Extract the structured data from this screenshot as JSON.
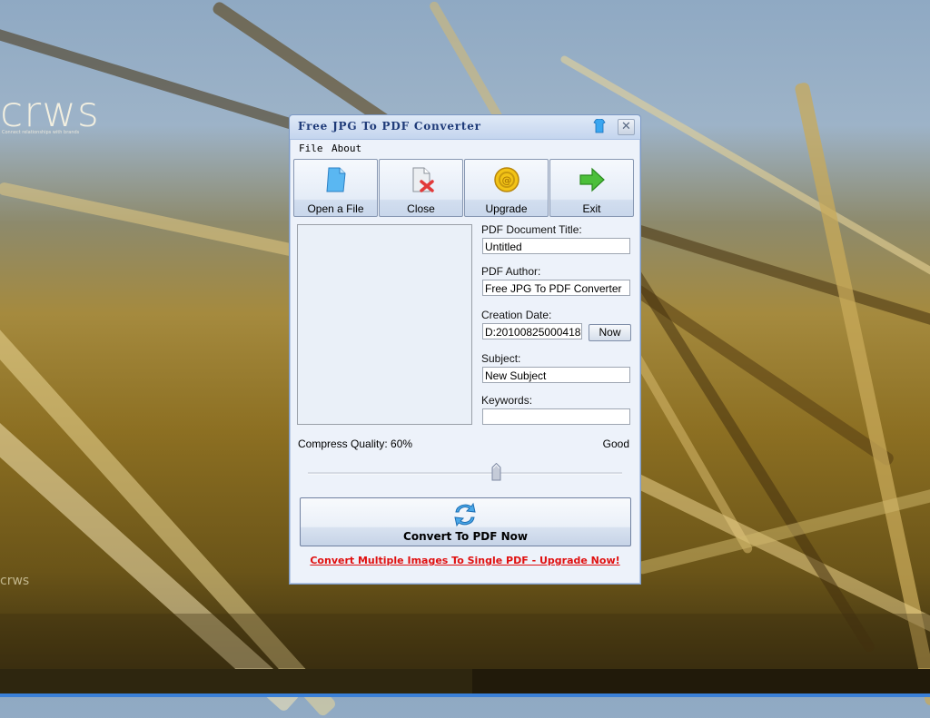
{
  "desktop": {
    "wallpaper_logo": "crws",
    "wallpaper_tagline": "Connect relationships with brands",
    "wallpaper_logo_small": "crws"
  },
  "window": {
    "title": "Free JPG To PDF Converter",
    "title_icons": [
      "shirt-icon",
      "close-icon"
    ],
    "close_label": "✕",
    "menu": [
      "File",
      "About"
    ],
    "toolbar": [
      {
        "label": "Open a File",
        "icon": "open-file-icon"
      },
      {
        "label": "Close",
        "icon": "close-file-icon"
      },
      {
        "label": "Upgrade",
        "icon": "coin-icon"
      },
      {
        "label": "Exit",
        "icon": "exit-arrow-icon"
      }
    ],
    "fields": {
      "title_label": "PDF Document Title:",
      "title_value": "Untitled",
      "author_label": "PDF Author:",
      "author_value": "Free JPG To PDF Converter",
      "date_label": "Creation Date:",
      "date_value": "D:20100825000418",
      "now_button": "Now",
      "subject_label": "Subject:",
      "subject_value": "New Subject",
      "keywords_label": "Keywords:",
      "keywords_value": ""
    },
    "quality": {
      "label": "Compress Quality: 60%",
      "value_percent": 60,
      "rating": "Good"
    },
    "convert_button": "Convert To PDF Now",
    "promo_link": "Convert Multiple Images To Single PDF - Upgrade Now!",
    "colors": {
      "title_text": "#1e3a78",
      "promo": "#e01010",
      "taskbar": "#3a80d8"
    }
  }
}
